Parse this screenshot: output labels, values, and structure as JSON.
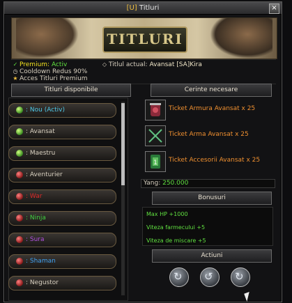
{
  "window": {
    "code": "[U]",
    "title": "Titluri",
    "close_label": "×"
  },
  "banner": {
    "logo_text": "TITLURI"
  },
  "info": {
    "premium_label": "Premium:",
    "premium_status": "Activ",
    "cooldown": "Cooldown Redus 90%",
    "acces": "Acces Titluri Premium",
    "titlu_label": "Titlul actual:",
    "titlu_value": "Avansat  [SA]Kira"
  },
  "left": {
    "header": "Titluri disponibile",
    "items": [
      {
        "label": ": Nou  (Activ)",
        "color": "#4ec8e8",
        "dot": "green"
      },
      {
        "label": ": Avansat",
        "color": "#d8d0c0",
        "dot": "green"
      },
      {
        "label": ": Maestru",
        "color": "#d8d0c0",
        "dot": "green"
      },
      {
        "label": ": Aventurier",
        "color": "#d8d0c0",
        "dot": "red"
      },
      {
        "label": ": War",
        "color": "#e02a2a",
        "dot": "red"
      },
      {
        "label": ": Ninja",
        "color": "#40d040",
        "dot": "red"
      },
      {
        "label": ": Sura",
        "color": "#b050e0",
        "dot": "red"
      },
      {
        "label": ": Shaman",
        "color": "#40a0f0",
        "dot": "red"
      },
      {
        "label": ": Negustor",
        "color": "#d8d0c0",
        "dot": "red"
      }
    ]
  },
  "right": {
    "req_header": "Cerinte necesare",
    "requirements": [
      {
        "icon": "armor-icon",
        "text": "Ticket Armura Avansat x 25"
      },
      {
        "icon": "weapon-icon",
        "text": "Ticket Arma Avansat x 25"
      },
      {
        "icon": "accessory-icon",
        "text": "Ticket Accesorii Avansat x 25"
      }
    ],
    "yang_label": "Yang:",
    "yang_value": "250.000",
    "bonus_header": "Bonusuri",
    "bonuses": [
      "Max HP +1000",
      "Viteza farmecului +5",
      "Viteza de miscare +5"
    ],
    "actions_header": "Actiuni"
  },
  "colors": {
    "accent": "#f0c040",
    "positive": "#60e040",
    "requirement": "#f09030"
  }
}
